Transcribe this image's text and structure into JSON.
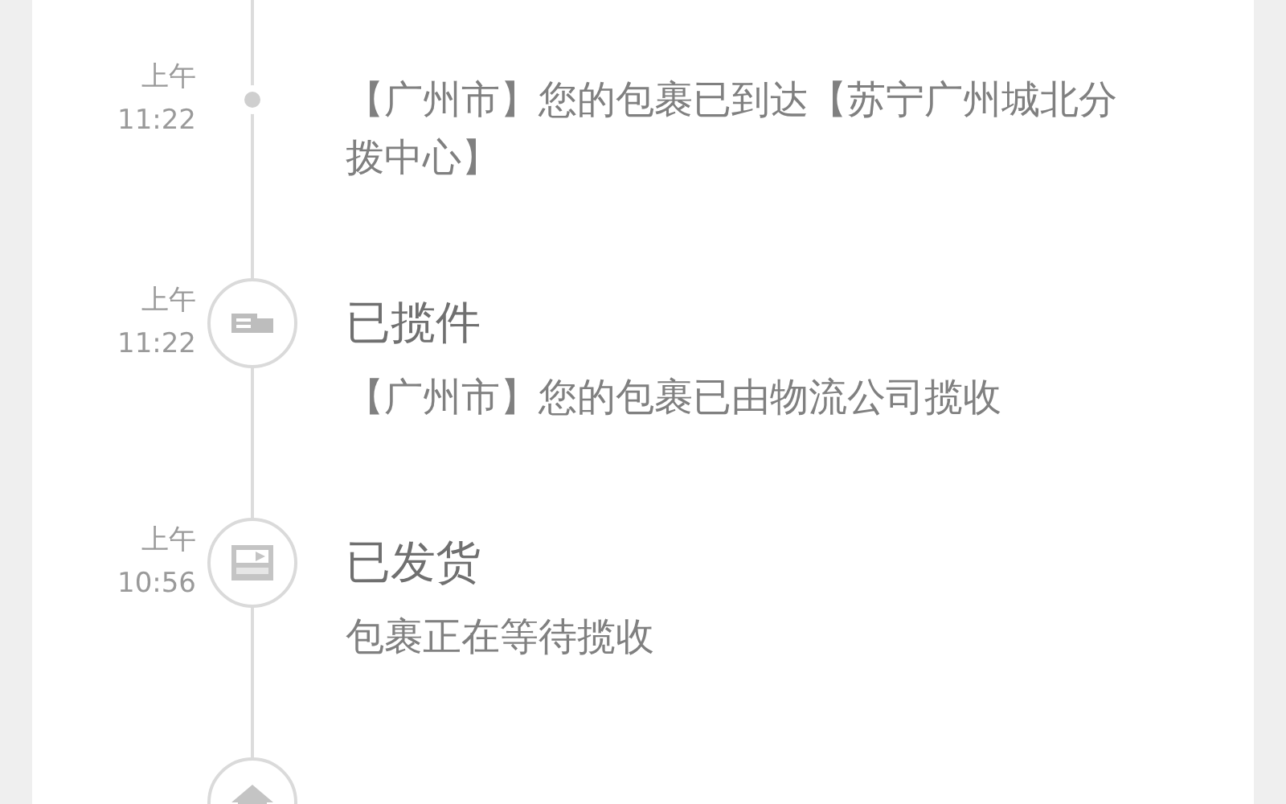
{
  "timeline": [
    {
      "kind": "dot",
      "period": "上午",
      "time": "11:22",
      "detail": "【广州市】您的包裹已到达【苏宁广州城北分拨中心】"
    },
    {
      "kind": "truck",
      "period": "上午",
      "time": "11:22",
      "title": "已揽件",
      "detail": "【广州市】您的包裹已由物流公司揽收"
    },
    {
      "kind": "card",
      "period": "上午",
      "time": "10:56",
      "title": "已发货",
      "detail": "包裹正在等待揽收"
    },
    {
      "kind": "house"
    }
  ]
}
